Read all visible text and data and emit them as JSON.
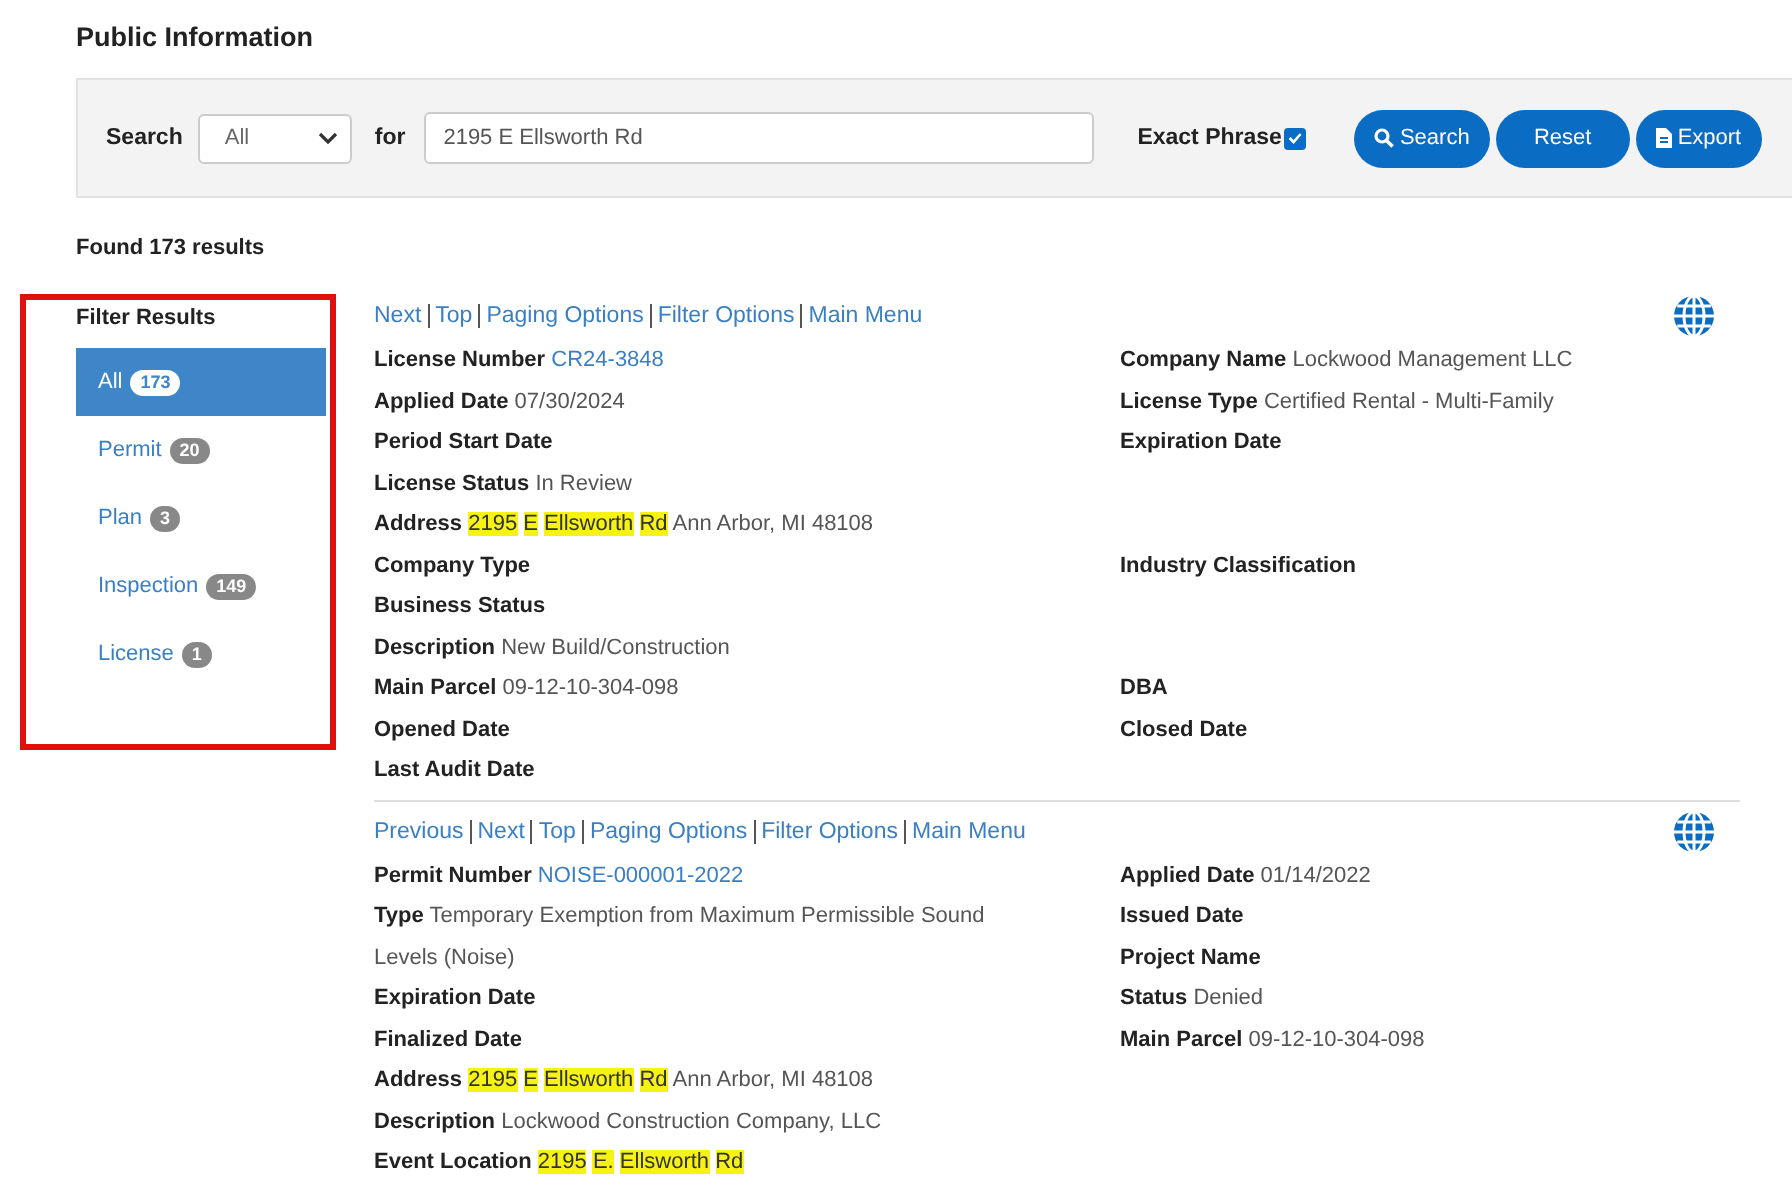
{
  "page_title": "Public Information",
  "search": {
    "label": "Search",
    "scope": "All",
    "for_label": "for",
    "value": "2195 E Ellsworth Rd",
    "exact_phrase": {
      "label": "Exact Phrase",
      "checked": true
    },
    "buttons": [
      {
        "label": "Search",
        "kind": "search"
      },
      {
        "label": "Reset",
        "kind": "plain"
      },
      {
        "label": "Export",
        "kind": "export"
      }
    ]
  },
  "results_count": "Found 173 results",
  "filter": {
    "title": "Filter Results",
    "items": [
      {
        "label": "All",
        "count": "173",
        "selected": true
      },
      {
        "label": "Permit",
        "count": "20",
        "selected": false
      },
      {
        "label": "Plan",
        "count": "3",
        "selected": false
      },
      {
        "label": "Inspection",
        "count": "149",
        "selected": false
      },
      {
        "label": "License",
        "count": "1",
        "selected": false
      }
    ]
  },
  "records": [
    {
      "nav": [
        "Next",
        "Top",
        "Paging Options",
        "Filter Options",
        "Main Menu"
      ],
      "rows": [
        {
          "left": {
            "label": "License Number",
            "parts": [
              {
                "text": "CR24-3848",
                "kind": "link"
              }
            ]
          },
          "right": {
            "label": "Company Name",
            "parts": [
              {
                "text": "Lockwood Management LLC",
                "kind": "plain"
              }
            ]
          }
        },
        {
          "left": {
            "label": "Applied Date",
            "parts": [
              {
                "text": "07/30/2024",
                "kind": "plain"
              }
            ]
          },
          "right": {
            "label": "License Type",
            "parts": [
              {
                "text": "Certified Rental - Multi-Family",
                "kind": "plain"
              }
            ]
          }
        },
        {
          "left": {
            "label": "Period Start Date"
          },
          "right": {
            "label": "Expiration Date"
          }
        },
        {
          "left": {
            "label": "License Status",
            "parts": [
              {
                "text": "In Review",
                "kind": "plain"
              }
            ]
          }
        },
        {
          "left": {
            "label": "Address",
            "parts": [
              {
                "text": "2195 E Ellsworth Rd",
                "kind": "mark"
              },
              {
                "text": " Ann Arbor, MI 48108",
                "kind": "plain"
              }
            ]
          }
        },
        {
          "left": {
            "label": "Company Type"
          },
          "right": {
            "label": "Industry Classification"
          }
        },
        {
          "left": {
            "label": "Business Status"
          }
        },
        {
          "left": {
            "label": "Description",
            "parts": [
              {
                "text": "New Build/Construction",
                "kind": "plain"
              }
            ]
          }
        },
        {
          "left": {
            "label": "Main Parcel",
            "parts": [
              {
                "text": "09-12-10-304-098",
                "kind": "plain"
              }
            ]
          },
          "right": {
            "label": "DBA"
          }
        },
        {
          "left": {
            "label": "Opened Date"
          },
          "right": {
            "label": "Closed Date"
          }
        },
        {
          "left": {
            "label": "Last Audit Date"
          }
        }
      ]
    },
    {
      "nav": [
        "Previous",
        "Next",
        "Top",
        "Paging Options",
        "Filter Options",
        "Main Menu"
      ],
      "rows": [
        {
          "left": {
            "label": "Permit Number",
            "parts": [
              {
                "text": "NOISE-000001-2022",
                "kind": "link"
              }
            ]
          },
          "right": {
            "label": "Applied Date",
            "parts": [
              {
                "text": "01/14/2022",
                "kind": "plain"
              }
            ]
          }
        },
        {
          "left": {
            "label": "Type",
            "parts": [
              {
                "text": "Temporary Exemption from Maximum Permissible Sound",
                "kind": "plain"
              }
            ]
          },
          "right": {
            "label": "Issued Date"
          }
        },
        {
          "left": {
            "parts": [
              {
                "text": "Levels (Noise)",
                "kind": "plain"
              }
            ]
          },
          "right": {
            "label": "Project Name"
          }
        },
        {
          "left": {
            "label": "Expiration Date"
          },
          "right": {
            "label": "Status",
            "parts": [
              {
                "text": "Denied",
                "kind": "plain"
              }
            ]
          }
        },
        {
          "left": {
            "label": "Finalized Date"
          },
          "right": {
            "label": "Main Parcel",
            "parts": [
              {
                "text": "09-12-10-304-098",
                "kind": "plain"
              }
            ]
          }
        },
        {
          "left": {
            "label": "Address",
            "parts": [
              {
                "text": "2195 E Ellsworth Rd",
                "kind": "mark"
              },
              {
                "text": " Ann Arbor, MI 48108",
                "kind": "plain"
              }
            ]
          }
        },
        {
          "left": {
            "label": "Description",
            "parts": [
              {
                "text": "Lockwood Construction Company, LLC",
                "kind": "plain"
              }
            ]
          }
        },
        {
          "left": {
            "label": "Event Location",
            "parts": [
              {
                "text": "2195 E. Ellsworth Rd",
                "kind": "mark"
              }
            ]
          }
        }
      ]
    }
  ]
}
